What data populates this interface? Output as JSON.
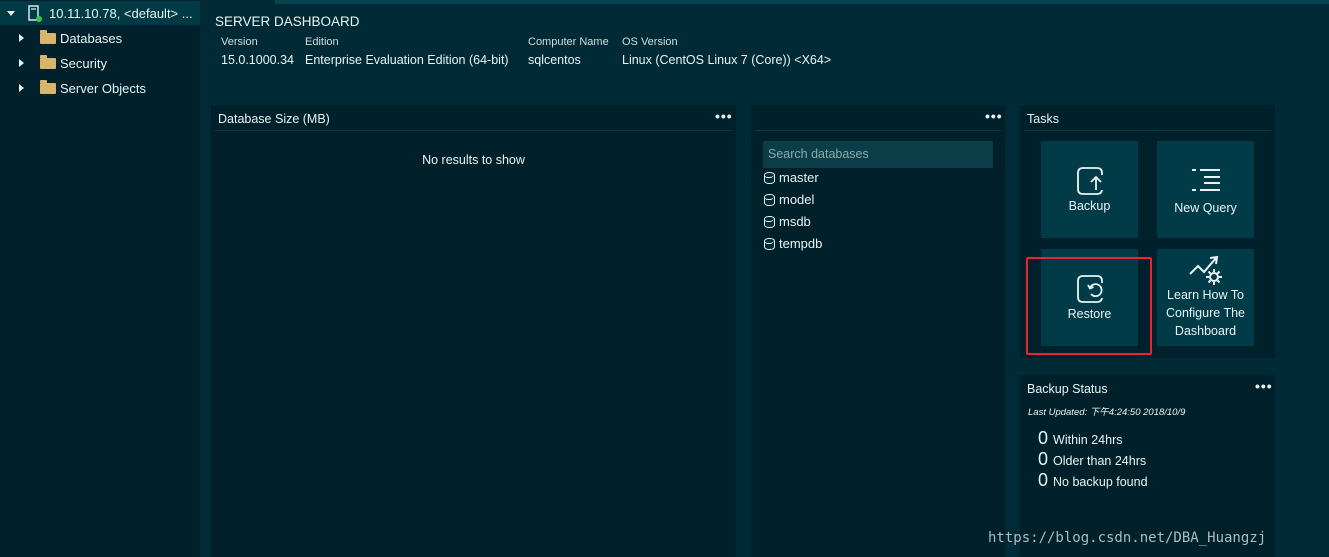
{
  "sidebar": {
    "server": "10.11.10.78, <default> ...",
    "items": [
      {
        "label": "Databases"
      },
      {
        "label": "Security"
      },
      {
        "label": "Server Objects"
      }
    ]
  },
  "header": {
    "title": "SERVER DASHBOARD",
    "props": [
      {
        "label": "Version",
        "value": "15.0.1000.34"
      },
      {
        "label": "Edition",
        "value": "Enterprise Evaluation Edition (64-bit)"
      },
      {
        "label": "Computer Name",
        "value": "sqlcentos"
      },
      {
        "label": "OS Version",
        "value": "Linux (CentOS Linux 7 (Core)) <X64>"
      }
    ]
  },
  "panels": {
    "dbsize": {
      "title": "Database Size (MB)",
      "empty": "No results to show",
      "more": "•••"
    },
    "dblist": {
      "search_placeholder": "Search databases",
      "more": "•••",
      "items": [
        "master",
        "model",
        "msdb",
        "tempdb"
      ]
    },
    "tasks": {
      "title": "Tasks",
      "tiles": [
        {
          "label": "Backup",
          "icon": "backup-icon"
        },
        {
          "label": "New Query",
          "icon": "new-query-icon"
        },
        {
          "label": "Restore",
          "icon": "restore-icon"
        },
        {
          "label": "Learn How To Configure The Dashboard",
          "icon": "configure-icon"
        }
      ]
    },
    "backup": {
      "title": "Backup Status",
      "more": "•••",
      "updated": "Last Updated: 下午4:24:50 2018/10/9",
      "stats": [
        {
          "count": "0",
          "label": "Within 24hrs"
        },
        {
          "count": "0",
          "label": "Older than 24hrs"
        },
        {
          "count": "0",
          "label": "No backup found"
        }
      ]
    }
  },
  "watermark": "https://blog.csdn.net/DBA_Huangzj",
  "colors": {
    "background": "#002b36",
    "panel": "#00212b",
    "tile": "#003b47",
    "highlight": "#e8262c"
  }
}
